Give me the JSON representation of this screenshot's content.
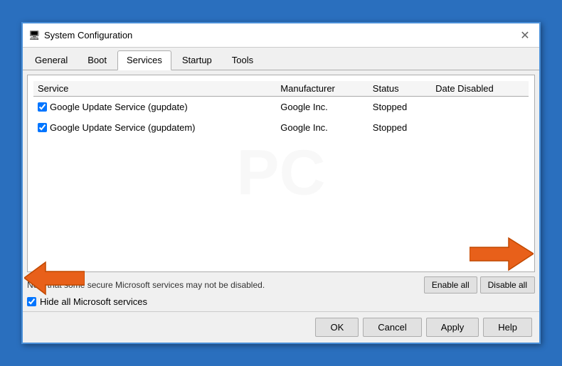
{
  "window": {
    "title": "System Configuration",
    "icon": "⚙",
    "close_label": "✕"
  },
  "tabs": [
    {
      "label": "General",
      "active": false
    },
    {
      "label": "Boot",
      "active": false
    },
    {
      "label": "Services",
      "active": true
    },
    {
      "label": "Startup",
      "active": false
    },
    {
      "label": "Tools",
      "active": false
    }
  ],
  "table": {
    "headers": [
      "Service",
      "Manufacturer",
      "Status",
      "Date Disabled"
    ],
    "rows": [
      {
        "checked": true,
        "service": "Google Update Service (gupdate)",
        "manufacturer": "Google Inc.",
        "status": "Stopped",
        "date_disabled": ""
      },
      {
        "checked": true,
        "service": "Google Update Service (gupdatem)",
        "manufacturer": "Google Inc.",
        "status": "Stopped",
        "date_disabled": ""
      }
    ]
  },
  "note": "Note that some secure Microsoft services may not be disabled.",
  "buttons": {
    "enable_all": "Enable all",
    "disable_all": "Disable all"
  },
  "hide_ms_label": "Hide all Microsoft services",
  "footer": {
    "ok": "OK",
    "cancel": "Cancel",
    "apply": "Apply",
    "help": "Help"
  },
  "watermark": "PC"
}
